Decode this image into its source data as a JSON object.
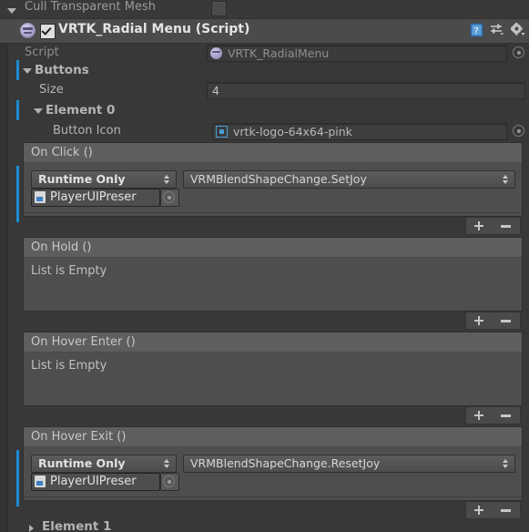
{
  "top_partial_row": {
    "label": "Cull Transparent Mesh",
    "checked": false
  },
  "component": {
    "title": "VRTK_Radial Menu (Script)",
    "enabled": true,
    "expanded": true,
    "header_icons": [
      {
        "name": "help-icon",
        "glyph": "?"
      },
      {
        "name": "preset-icon",
        "glyph": "presets"
      },
      {
        "name": "gear-icon",
        "glyph": "settings"
      }
    ],
    "script_field": {
      "label": "Script",
      "value": "VRTK_RadialMenu",
      "icon": "script-ball-icon",
      "readonly": true
    }
  },
  "buttons_array": {
    "label": "Buttons",
    "expanded": true,
    "size_label": "Size",
    "size_value": "4",
    "elements": [
      {
        "label": "Element 0",
        "expanded": true,
        "button_icon": {
          "label": "Button Icon",
          "value": "vrtk-logo-64x64-pink",
          "icon": "sprite-icon"
        },
        "events": [
          {
            "title": "On Click ()",
            "empty": false,
            "empty_text": "List is Empty",
            "entries": [
              {
                "mode": "Runtime Only",
                "function": "VRMBlendShapeChange.SetJoy",
                "target": "PlayerUIPreser",
                "target_icon": "script-asset-icon"
              }
            ],
            "add_label": "+",
            "remove_label": "–"
          },
          {
            "title": "On Hold ()",
            "empty": true,
            "empty_text": "List is Empty",
            "entries": [],
            "add_label": "+",
            "remove_label": "–"
          },
          {
            "title": "On Hover Enter ()",
            "empty": true,
            "empty_text": "List is Empty",
            "entries": [],
            "add_label": "+",
            "remove_label": "–"
          },
          {
            "title": "On Hover Exit ()",
            "empty": false,
            "empty_text": "List is Empty",
            "entries": [
              {
                "mode": "Runtime Only",
                "function": "VRMBlendShapeChange.ResetJoy",
                "target": "PlayerUIPreser",
                "target_icon": "script-asset-icon"
              }
            ],
            "add_label": "+",
            "remove_label": "–"
          }
        ]
      },
      {
        "label": "Element 1",
        "expanded": false
      }
    ]
  },
  "colors": {
    "window_bg": "#383838",
    "header_bg": "#4b4b4b",
    "event_bg": "#4e4e4e",
    "event_title_bg": "#5e5e5e",
    "override_bar": "#1d8bd1",
    "text": "#b4b4b4",
    "accent_blue": "#4a9fd8"
  }
}
